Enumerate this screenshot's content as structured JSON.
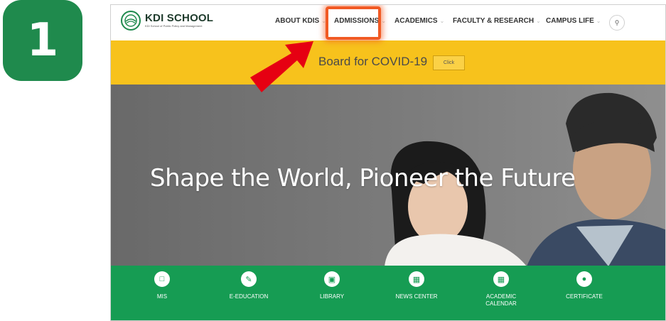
{
  "step": {
    "number": "1"
  },
  "logo": {
    "title": "KDI SCHOOL",
    "subtitle": "KDI School of Public Policy and Management"
  },
  "nav": {
    "items": [
      {
        "label": "ABOUT KDIS"
      },
      {
        "label": "ADMISSIONS"
      },
      {
        "label": "ACADEMICS"
      },
      {
        "label": "FACULTY & RESEARCH"
      },
      {
        "label": "CAMPUS LIFE"
      }
    ],
    "search_icon": "search-icon"
  },
  "banner": {
    "text": "Board for COVID-19",
    "button_label": "Click"
  },
  "hero": {
    "title": "Shape the World, Pioneer the Future"
  },
  "quick_links": [
    {
      "label": "MIS",
      "icon": "laptop-icon"
    },
    {
      "label": "E-EDUCATION",
      "icon": "pencil-icon"
    },
    {
      "label": "LIBRARY",
      "icon": "library-icon"
    },
    {
      "label": "NEWS CENTER",
      "icon": "news-icon"
    },
    {
      "label": "ACADEMIC\nCALENDAR",
      "icon": "calendar-icon"
    },
    {
      "label": "CERTIFICATE",
      "icon": "certificate-icon"
    }
  ],
  "colors": {
    "brand_green": "#169c53",
    "banner_yellow": "#f7c21c",
    "highlight_orange": "#f15a24",
    "arrow_red": "#e60012"
  }
}
